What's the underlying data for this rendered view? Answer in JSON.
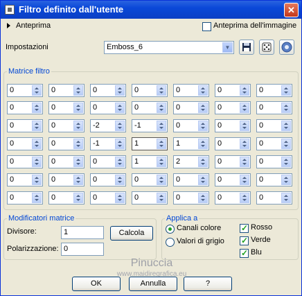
{
  "window": {
    "title": "Filtro definito dall'utente",
    "close_label": "✕"
  },
  "preview": {
    "toggle_label": "Anteprima",
    "image_preview_label": "Anteprima dell'immagine",
    "image_preview_checked": false
  },
  "settings": {
    "label": "Impostazioni",
    "preset_value": "Emboss_6"
  },
  "matrix": {
    "title": "Matrice filtro",
    "rows": [
      [
        "0",
        "0",
        "0",
        "0",
        "0",
        "0",
        "0"
      ],
      [
        "0",
        "0",
        "0",
        "0",
        "0",
        "0",
        "0"
      ],
      [
        "0",
        "0",
        "-2",
        "-1",
        "0",
        "0",
        "0"
      ],
      [
        "0",
        "0",
        "-1",
        "1",
        "1",
        "0",
        "0"
      ],
      [
        "0",
        "0",
        "0",
        "1",
        "2",
        "0",
        "0"
      ],
      [
        "0",
        "0",
        "0",
        "0",
        "0",
        "0",
        "0"
      ],
      [
        "0",
        "0",
        "0",
        "0",
        "0",
        "0",
        "0"
      ]
    ]
  },
  "modifiers": {
    "title": "Modificatori matrice",
    "divisor_label": "Divisore:",
    "divisor_value": "1",
    "calc_label": "Calcola",
    "bias_label": "Polarizzazione:",
    "bias_value": "0"
  },
  "apply": {
    "title": "Applica a",
    "color_channels_label": "Canali colore",
    "grey_values_label": "Valori di grigio",
    "selected": "color",
    "red_label": "Rosso",
    "green_label": "Verde",
    "blue_label": "Blu"
  },
  "watermark": {
    "line1": "Pinuccia",
    "line2": "www.maidiregrafica.eu"
  },
  "footer": {
    "ok_label": "OK",
    "cancel_label": "Annulla",
    "help_label": "?"
  }
}
